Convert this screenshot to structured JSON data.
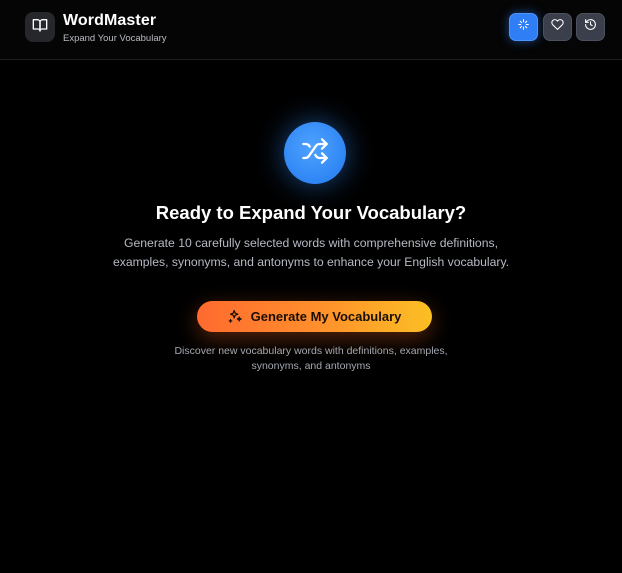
{
  "header": {
    "title": "WordMaster",
    "subtitle": "Expand Your Vocabulary",
    "logo_icon": "open-book-icon",
    "buttons": [
      {
        "icon": "sparkle-icon",
        "active": true
      },
      {
        "icon": "heart-icon",
        "active": false
      },
      {
        "icon": "history-icon",
        "active": false
      }
    ]
  },
  "hero": {
    "icon": "shuffle-icon",
    "title": "Ready to Expand Your Vocabulary?",
    "description": "Generate 10 carefully selected words with comprehensive definitions, examples, synonyms, and antonyms to enhance your English vocabulary.",
    "button_label": "Generate My Vocabulary",
    "button_icon": "sparkles-icon",
    "hint": "Discover new vocabulary words with definitions, examples, synonyms, and antonyms"
  },
  "colors": {
    "background": "#000000",
    "accent_blue": "#2f7ef5",
    "button_gradient_start": "#ff6a2f",
    "button_gradient_end": "#fbbf24"
  }
}
